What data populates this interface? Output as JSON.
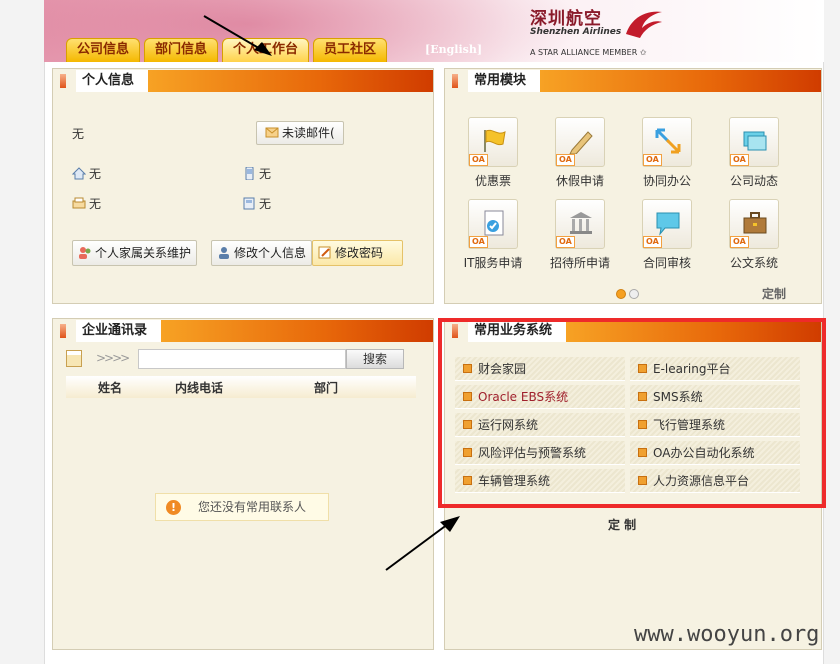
{
  "header": {
    "tabs": [
      "公司信息",
      "部门信息",
      "个人工作台",
      "员工社区"
    ],
    "english_link": "[English]",
    "logo": {
      "cn": "深圳航空",
      "en": "Shenzhen Airlines",
      "alliance": "A STAR ALLIANCE MEMBER"
    }
  },
  "personal": {
    "title": "个人信息",
    "name_value": "无",
    "unread_mail": "未读邮件(",
    "home_value": "无",
    "mobile_value": "无",
    "fax_value": "无",
    "phone_value": "无",
    "buttons": [
      "个人家属关系维护",
      "修改个人信息",
      "修改密码"
    ]
  },
  "modules": {
    "title": "常用模块",
    "badge": "OA",
    "items": [
      "优惠票",
      "休假申请",
      "协同办公",
      "公司动态",
      "IT服务申请",
      "招待所申请",
      "合同审核",
      "公文系统"
    ],
    "custom": "定制"
  },
  "contacts": {
    "title": "企业通讯录",
    "search_button": "搜索",
    "columns": [
      "姓名",
      "内线电话",
      "部门"
    ],
    "empty_message": "您还没有常用联系人"
  },
  "business": {
    "title": "常用业务系统",
    "items": [
      "财会家园",
      "E-learing平台",
      "Oracle EBS系统",
      "SMS系统",
      "运行网系统",
      "飞行管理系统",
      "风险评估与预警系统",
      "OA办公自动化系统",
      "车辆管理系统",
      "人力资源信息平台"
    ],
    "custom": "定 制"
  },
  "watermark": "www.wooyun.org"
}
